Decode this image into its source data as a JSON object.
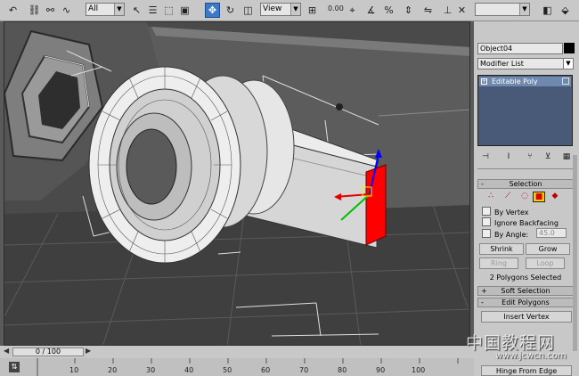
{
  "toolbar": {
    "selection_filter": "All",
    "reference_coord": "View",
    "snap_readout": "0.00",
    "icons": [
      "undo-icon",
      "redo-icon",
      "link-icon",
      "unlink-icon",
      "bind-space-warp-icon",
      "select-icon",
      "select-by-name-icon",
      "rect-select-icon",
      "window-crossing-icon",
      "move-icon",
      "rotate-icon",
      "scale-icon",
      "pivot-icon",
      "snap-icon",
      "angle-snap-icon",
      "percent-snap-icon",
      "spinner-snap-icon",
      "mirror-icon",
      "align-icon",
      "named-selection-icon",
      "curve-editor-icon",
      "schematic-icon",
      "material-editor-icon",
      "render-icon"
    ]
  },
  "viewport": {
    "accent_red": "#e00000",
    "axis_z_color": "#0000ff",
    "axis_y_color": "#00c000"
  },
  "command_panel": {
    "object_name": "Object04",
    "object_color": "#000000",
    "modifier_list": "Modifier List",
    "stack_items": [
      "Editable Poly"
    ],
    "selection_rollout": {
      "title": "Selection",
      "subobject_icons": [
        "vertex-icon",
        "edge-icon",
        "border-icon",
        "polygon-icon",
        "element-icon"
      ],
      "active_subobject": "polygon-icon",
      "by_vertex": "By Vertex",
      "ignore_backfacing": "Ignore Backfacing",
      "by_angle": "By Angle:",
      "angle_value": "45.0",
      "shrink": "Shrink",
      "grow": "Grow",
      "ring": "Ring",
      "loop": "Loop",
      "status": "2 Polygons Selected"
    },
    "soft_selection": "Soft Selection",
    "edit_polygons": "Edit Polygons",
    "insert_vertex": "Insert Vertex",
    "hinge_from_edge": "Hinge From Edge"
  },
  "timeline": {
    "frame_slider": "0 / 100",
    "ticks": [
      "10",
      "20",
      "30",
      "40",
      "50",
      "60",
      "70",
      "80",
      "90",
      "100"
    ]
  },
  "watermark": {
    "text": "中国教程网",
    "url": "www.jcwcn.com"
  }
}
